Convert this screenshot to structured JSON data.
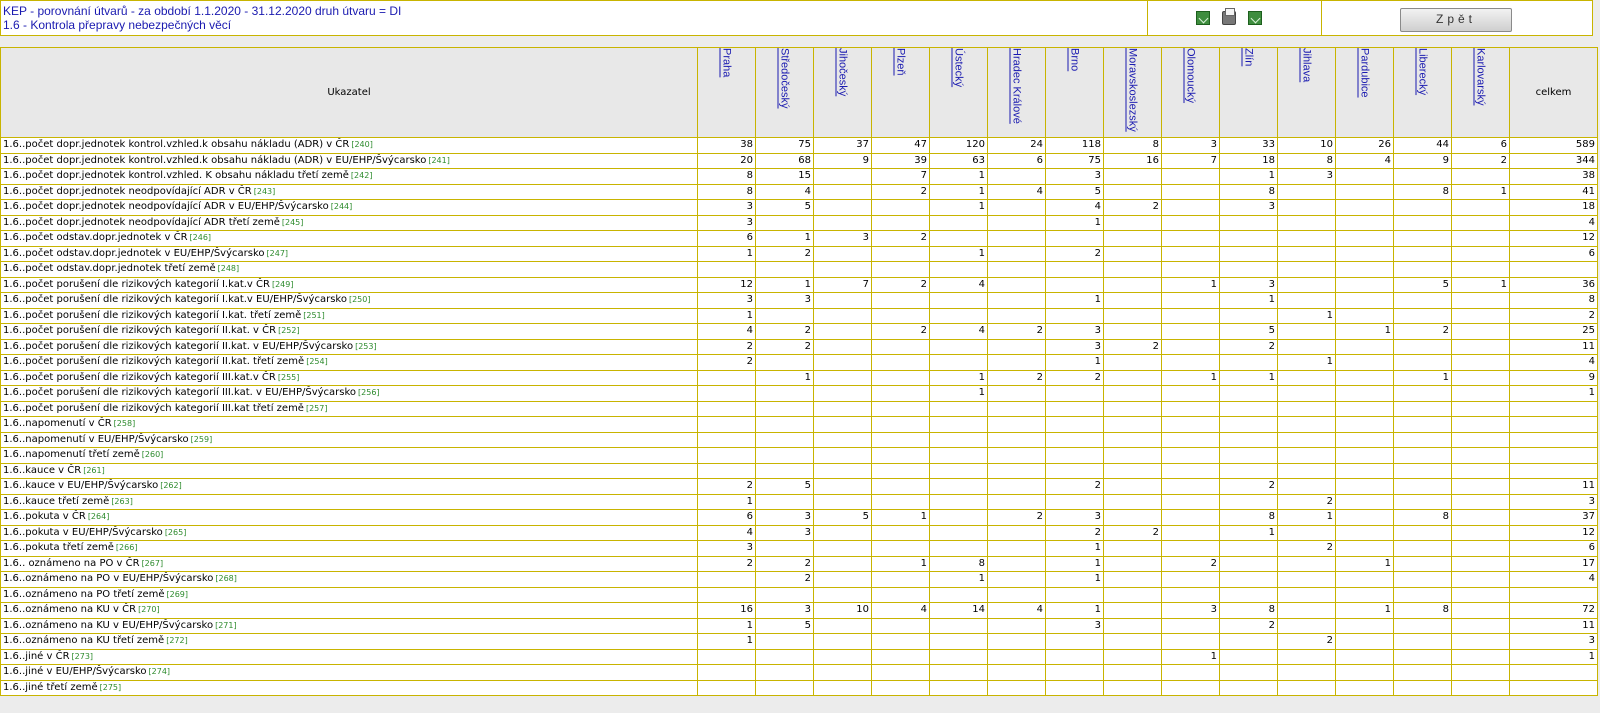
{
  "header": {
    "title_line1": "KEP - porovnání útvarů - za období 1.1.2020 - 31.12.2020 druh útvaru = DI",
    "title_line2": "1.6 - Kontrola přepravy nebezpečných věcí",
    "back_label": "Zpět"
  },
  "table": {
    "indicator_header": "Ukazatel",
    "total_header": "celkem",
    "regions": [
      "Praha",
      "Středočeský",
      "Jihočeský",
      "Plzeň",
      "Ústecký",
      "Hradec Králové",
      "Brno",
      "Moravskoslezský",
      "Olomoucký",
      "Zlín",
      "Jihlava",
      "Pardubice",
      "Liberecký",
      "Karlovarský"
    ],
    "rows": [
      {
        "label": "1.6..počet dopr.jednotek kontrol.vzhled.k obsahu nákladu (ADR) v ČR",
        "code": "[240]",
        "values": [
          "38",
          "75",
          "37",
          "47",
          "120",
          "24",
          "118",
          "8",
          "3",
          "33",
          "10",
          "26",
          "44",
          "6"
        ],
        "total": "589"
      },
      {
        "label": "1.6..počet dopr.jednotek kontrol.vzhled.k obsahu nákladu (ADR) v EU/EHP/Švýcarsko",
        "code": "[241]",
        "values": [
          "20",
          "68",
          "9",
          "39",
          "63",
          "6",
          "75",
          "16",
          "7",
          "18",
          "8",
          "4",
          "9",
          "2"
        ],
        "total": "344"
      },
      {
        "label": "1.6..počet dopr.jednotek kontrol.vzhled. K obsahu nákladu třetí země",
        "code": "[242]",
        "values": [
          "8",
          "15",
          "",
          "7",
          "1",
          "",
          "3",
          "",
          "",
          "1",
          "3",
          "",
          "",
          ""
        ],
        "total": "38"
      },
      {
        "label": "1.6..počet dopr.jednotek neodpovídající ADR v ČR",
        "code": "[243]",
        "values": [
          "8",
          "4",
          "",
          "2",
          "1",
          "4",
          "5",
          "",
          "",
          "8",
          "",
          "",
          "8",
          "1"
        ],
        "total": "41"
      },
      {
        "label": "1.6..počet dopr.jednotek neodpovídající ADR v EU/EHP/Švýcarsko",
        "code": "[244]",
        "values": [
          "3",
          "5",
          "",
          "",
          "1",
          "",
          "4",
          "2",
          "",
          "3",
          "",
          "",
          "",
          ""
        ],
        "total": "18"
      },
      {
        "label": "1.6..počet dopr.jednotek neodpovídající ADR třetí země",
        "code": "[245]",
        "values": [
          "3",
          "",
          "",
          "",
          "",
          "",
          "1",
          "",
          "",
          "",
          "",
          "",
          "",
          ""
        ],
        "total": "4"
      },
      {
        "label": "1.6..počet odstav.dopr.jednotek v ČR",
        "code": "[246]",
        "values": [
          "6",
          "1",
          "3",
          "2",
          "",
          "",
          "",
          "",
          "",
          "",
          "",
          "",
          "",
          ""
        ],
        "total": "12"
      },
      {
        "label": "1.6..počet odstav.dopr.jednotek v EU/EHP/Švýcarsko",
        "code": "[247]",
        "values": [
          "1",
          "2",
          "",
          "",
          "1",
          "",
          "2",
          "",
          "",
          "",
          "",
          "",
          "",
          ""
        ],
        "total": "6"
      },
      {
        "label": "1.6..počet odstav.dopr.jednotek třetí země",
        "code": "[248]",
        "values": [
          "",
          "",
          "",
          "",
          "",
          "",
          "",
          "",
          "",
          "",
          "",
          "",
          "",
          ""
        ],
        "total": ""
      },
      {
        "label": "1.6..počet porušení dle rizikových kategorií I.kat.v ČR",
        "code": "[249]",
        "values": [
          "12",
          "1",
          "7",
          "2",
          "4",
          "",
          "",
          "",
          "1",
          "3",
          "",
          "",
          "5",
          "1"
        ],
        "total": "36"
      },
      {
        "label": "1.6..počet porušení dle rizikových kategorií I.kat.v EU/EHP/Švýcarsko",
        "code": "[250]",
        "values": [
          "3",
          "3",
          "",
          "",
          "",
          "",
          "1",
          "",
          "",
          "1",
          "",
          "",
          "",
          ""
        ],
        "total": "8"
      },
      {
        "label": "1.6..počet porušení dle rizikových kategorií I.kat. třetí země",
        "code": "[251]",
        "values": [
          "1",
          "",
          "",
          "",
          "",
          "",
          "",
          "",
          "",
          "",
          "1",
          "",
          "",
          ""
        ],
        "total": "2"
      },
      {
        "label": "1.6..počet porušení dle rizikových kategorií II.kat. v ČR",
        "code": "[252]",
        "values": [
          "4",
          "2",
          "",
          "2",
          "4",
          "2",
          "3",
          "",
          "",
          "5",
          "",
          "1",
          "2",
          ""
        ],
        "total": "25"
      },
      {
        "label": "1.6..počet porušení dle rizikových kategorií II.kat. v EU/EHP/Švýcarsko",
        "code": "[253]",
        "values": [
          "2",
          "2",
          "",
          "",
          "",
          "",
          "3",
          "2",
          "",
          "2",
          "",
          "",
          "",
          ""
        ],
        "total": "11"
      },
      {
        "label": "1.6..počet porušení dle rizikových kategorií II.kat. třetí země",
        "code": "[254]",
        "values": [
          "2",
          "",
          "",
          "",
          "",
          "",
          "1",
          "",
          "",
          "",
          "1",
          "",
          "",
          ""
        ],
        "total": "4"
      },
      {
        "label": "1.6..počet porušení dle rizikových kategorií III.kat.v ČR",
        "code": "[255]",
        "values": [
          "",
          "1",
          "",
          "",
          "1",
          "2",
          "2",
          "",
          "1",
          "1",
          "",
          "",
          "1",
          ""
        ],
        "total": "9"
      },
      {
        "label": "1.6..počet porušení dle rizikových kategorií III.kat. v EU/EHP/Švýcarsko",
        "code": "[256]",
        "values": [
          "",
          "",
          "",
          "",
          "1",
          "",
          "",
          "",
          "",
          "",
          "",
          "",
          "",
          ""
        ],
        "total": "1"
      },
      {
        "label": "1.6..počet porušení dle rizikových kategorií III.kat třetí země",
        "code": "[257]",
        "values": [
          "",
          "",
          "",
          "",
          "",
          "",
          "",
          "",
          "",
          "",
          "",
          "",
          "",
          ""
        ],
        "total": ""
      },
      {
        "label": "1.6..napomenutí v ČR",
        "code": "[258]",
        "values": [
          "",
          "",
          "",
          "",
          "",
          "",
          "",
          "",
          "",
          "",
          "",
          "",
          "",
          ""
        ],
        "total": ""
      },
      {
        "label": "1.6..napomenutí v EU/EHP/Švýcarsko",
        "code": "[259]",
        "values": [
          "",
          "",
          "",
          "",
          "",
          "",
          "",
          "",
          "",
          "",
          "",
          "",
          "",
          ""
        ],
        "total": ""
      },
      {
        "label": "1.6..napomenutí třetí země",
        "code": "[260]",
        "values": [
          "",
          "",
          "",
          "",
          "",
          "",
          "",
          "",
          "",
          "",
          "",
          "",
          "",
          ""
        ],
        "total": ""
      },
      {
        "label": "1.6..kauce v ČR",
        "code": "[261]",
        "values": [
          "",
          "",
          "",
          "",
          "",
          "",
          "",
          "",
          "",
          "",
          "",
          "",
          "",
          ""
        ],
        "total": ""
      },
      {
        "label": "1.6..kauce v EU/EHP/Švýcarsko",
        "code": "[262]",
        "values": [
          "2",
          "5",
          "",
          "",
          "",
          "",
          "2",
          "",
          "",
          "2",
          "",
          "",
          "",
          ""
        ],
        "total": "11"
      },
      {
        "label": "1.6..kauce třetí země",
        "code": "[263]",
        "values": [
          "1",
          "",
          "",
          "",
          "",
          "",
          "",
          "",
          "",
          "",
          "2",
          "",
          "",
          ""
        ],
        "total": "3"
      },
      {
        "label": "1.6..pokuta v ČR",
        "code": "[264]",
        "values": [
          "6",
          "3",
          "5",
          "1",
          "",
          "2",
          "3",
          "",
          "",
          "8",
          "1",
          "",
          "8",
          ""
        ],
        "total": "37"
      },
      {
        "label": "1.6..pokuta v EU/EHP/Švýcarsko",
        "code": "[265]",
        "values": [
          "4",
          "3",
          "",
          "",
          "",
          "",
          "2",
          "2",
          "",
          "1",
          "",
          "",
          "",
          ""
        ],
        "total": "12"
      },
      {
        "label": "1.6..pokuta třetí země",
        "code": "[266]",
        "values": [
          "3",
          "",
          "",
          "",
          "",
          "",
          "1",
          "",
          "",
          "",
          "2",
          "",
          "",
          ""
        ],
        "total": "6"
      },
      {
        "label": "1.6.. oznámeno na PO v ČR",
        "code": "[267]",
        "values": [
          "2",
          "2",
          "",
          "1",
          "8",
          "",
          "1",
          "",
          "2",
          "",
          "",
          "1",
          "",
          ""
        ],
        "total": "17"
      },
      {
        "label": "1.6..oznámeno na PO v EU/EHP/Švýcarsko",
        "code": "[268]",
        "values": [
          "",
          "2",
          "",
          "",
          "1",
          "",
          "1",
          "",
          "",
          "",
          "",
          "",
          "",
          ""
        ],
        "total": "4"
      },
      {
        "label": "1.6..oznámeno na PO třetí země",
        "code": "[269]",
        "values": [
          "",
          "",
          "",
          "",
          "",
          "",
          "",
          "",
          "",
          "",
          "",
          "",
          "",
          ""
        ],
        "total": ""
      },
      {
        "label": "1.6..oznámeno na KU v ČR",
        "code": "[270]",
        "values": [
          "16",
          "3",
          "10",
          "4",
          "14",
          "4",
          "1",
          "",
          "3",
          "8",
          "",
          "1",
          "8",
          ""
        ],
        "total": "72"
      },
      {
        "label": "1.6..oznámeno na KU v EU/EHP/Švýcarsko",
        "code": "[271]",
        "values": [
          "1",
          "5",
          "",
          "",
          "",
          "",
          "3",
          "",
          "",
          "2",
          "",
          "",
          "",
          ""
        ],
        "total": "11"
      },
      {
        "label": "1.6..oznámeno na KU třetí země",
        "code": "[272]",
        "values": [
          "1",
          "",
          "",
          "",
          "",
          "",
          "",
          "",
          "",
          "",
          "2",
          "",
          "",
          ""
        ],
        "total": "3"
      },
      {
        "label": "1.6..jiné v ČR",
        "code": "[273]",
        "values": [
          "",
          "",
          "",
          "",
          "",
          "",
          "",
          "",
          "1",
          "",
          "",
          "",
          "",
          ""
        ],
        "total": "1"
      },
      {
        "label": "1.6..jiné v EU/EHP/Švýcarsko",
        "code": "[274]",
        "values": [
          "",
          "",
          "",
          "",
          "",
          "",
          "",
          "",
          "",
          "",
          "",
          "",
          "",
          ""
        ],
        "total": ""
      },
      {
        "label": "1.6..jiné třetí země",
        "code": "[275]",
        "values": [
          "",
          "",
          "",
          "",
          "",
          "",
          "",
          "",
          "",
          "",
          "",
          "",
          "",
          ""
        ],
        "total": ""
      }
    ]
  }
}
